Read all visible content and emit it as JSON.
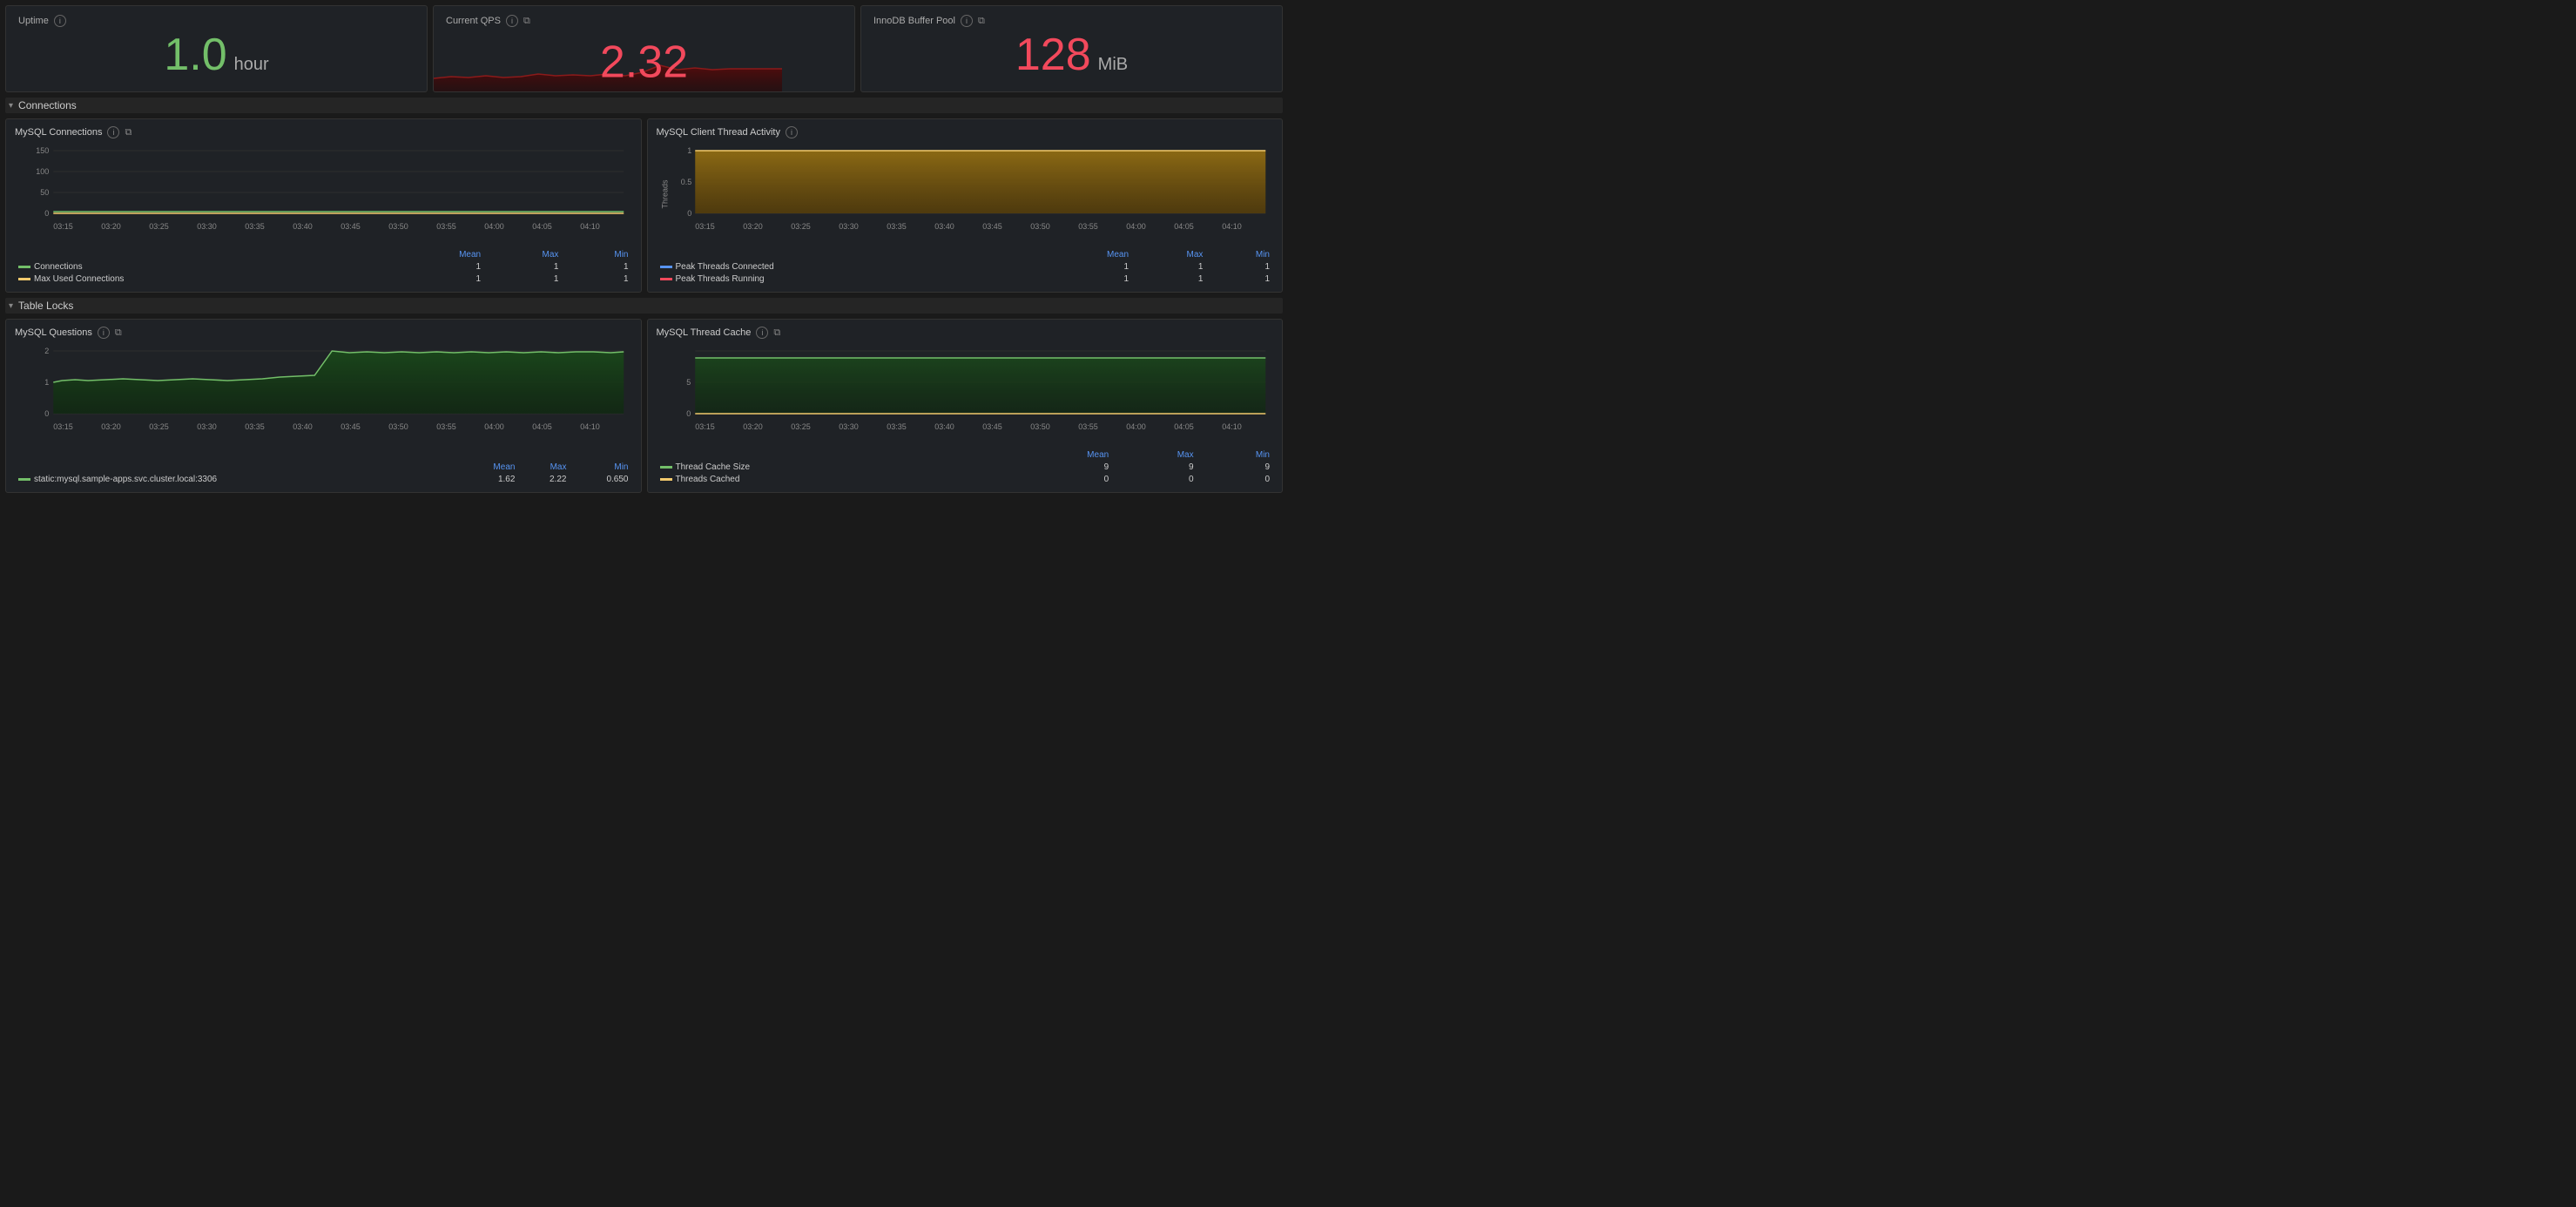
{
  "topPanels": {
    "uptime": {
      "title": "Uptime",
      "value": "1.0",
      "unit": "hour",
      "color": "#73bf69"
    },
    "qps": {
      "title": "Current QPS",
      "value": "2.32",
      "color": "#f2495c"
    },
    "innodb": {
      "title": "InnoDB Buffer Pool",
      "value": "128",
      "unit": "MiB",
      "color": "#f2495c"
    }
  },
  "sections": {
    "connections": {
      "label": "Connections"
    },
    "tableLocks": {
      "label": "Table Locks"
    }
  },
  "charts": {
    "mysqlConnections": {
      "title": "MySQL Connections",
      "yLabels": [
        "150",
        "100",
        "50",
        "0"
      ],
      "xLabels": [
        "03:15",
        "03:20",
        "03:25",
        "03:30",
        "03:35",
        "03:40",
        "03:45",
        "03:50",
        "03:55",
        "04:00",
        "04:05",
        "04:10"
      ],
      "legends": [
        {
          "name": "Connections",
          "color": "#73bf69",
          "mean": "1",
          "max": "1",
          "min": "1"
        },
        {
          "name": "Max Used Connections",
          "color": "#f2c96d",
          "mean": "1",
          "max": "1",
          "min": "1"
        }
      ]
    },
    "mysqlClientThread": {
      "title": "MySQL Client Thread Activity",
      "yAxisLabel": "Threads",
      "yLabels": [
        "1",
        "0.5",
        "0"
      ],
      "xLabels": [
        "03:15",
        "03:20",
        "03:25",
        "03:30",
        "03:35",
        "03:40",
        "03:45",
        "03:50",
        "03:55",
        "04:00",
        "04:05",
        "04:10"
      ],
      "legends": [
        {
          "name": "Peak Threads Connected",
          "color": "#5794f2",
          "mean": "1",
          "max": "1",
          "min": "1"
        },
        {
          "name": "Peak Threads Running",
          "color": "#f2495c",
          "mean": "1",
          "max": "1",
          "min": "1"
        }
      ]
    },
    "mysqlQuestions": {
      "title": "MySQL Questions",
      "yLabels": [
        "2",
        "1",
        "0"
      ],
      "xLabels": [
        "03:15",
        "03:20",
        "03:25",
        "03:30",
        "03:35",
        "03:40",
        "03:45",
        "03:50",
        "03:55",
        "04:00",
        "04:05",
        "04:10"
      ],
      "legends": [
        {
          "name": "static:mysql.sample-apps.svc.cluster.local:3306",
          "color": "#73bf69",
          "mean": "1.62",
          "max": "2.22",
          "min": "0.650"
        }
      ]
    },
    "mysqlThreadCache": {
      "title": "MySQL Thread Cache",
      "yLabels": [
        "5",
        "0"
      ],
      "xLabels": [
        "03:15",
        "03:20",
        "03:25",
        "03:30",
        "03:35",
        "03:40",
        "03:45",
        "03:50",
        "03:55",
        "04:00",
        "04:05",
        "04:10"
      ],
      "legends": [
        {
          "name": "Thread Cache Size",
          "color": "#73bf69",
          "mean": "9",
          "max": "9",
          "min": "9"
        },
        {
          "name": "Threads Cached",
          "color": "#f2c96d",
          "mean": "0",
          "max": "0",
          "min": "0"
        }
      ]
    }
  },
  "labels": {
    "mean": "Mean",
    "max": "Max",
    "min": "Min"
  }
}
